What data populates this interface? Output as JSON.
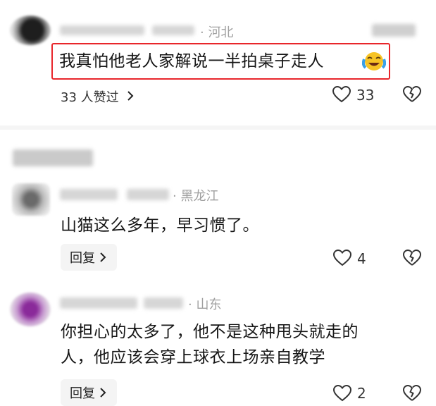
{
  "comments": [
    {
      "location": "· 河北",
      "text": "我真怕他老人家解说一半拍桌子走人",
      "emoji": "cry-laughing-face",
      "likers": "33 人赞过",
      "likes": "33"
    },
    {
      "location": "· 黑龙江",
      "text": "山猫这么多年，早习惯了。",
      "reply": "回复",
      "likes": "4"
    },
    {
      "location": "· 山东",
      "text_line1": "你担心的太多了，他不是这种甩头就走的",
      "text_line2": "人，他应该会穿上球衣上场亲自教学",
      "reply": "回复",
      "likes": "2"
    }
  ],
  "colors": {
    "highlight_border": "#e8262b",
    "muted": "#a0a0a0",
    "divider": "#f5f5f5"
  }
}
